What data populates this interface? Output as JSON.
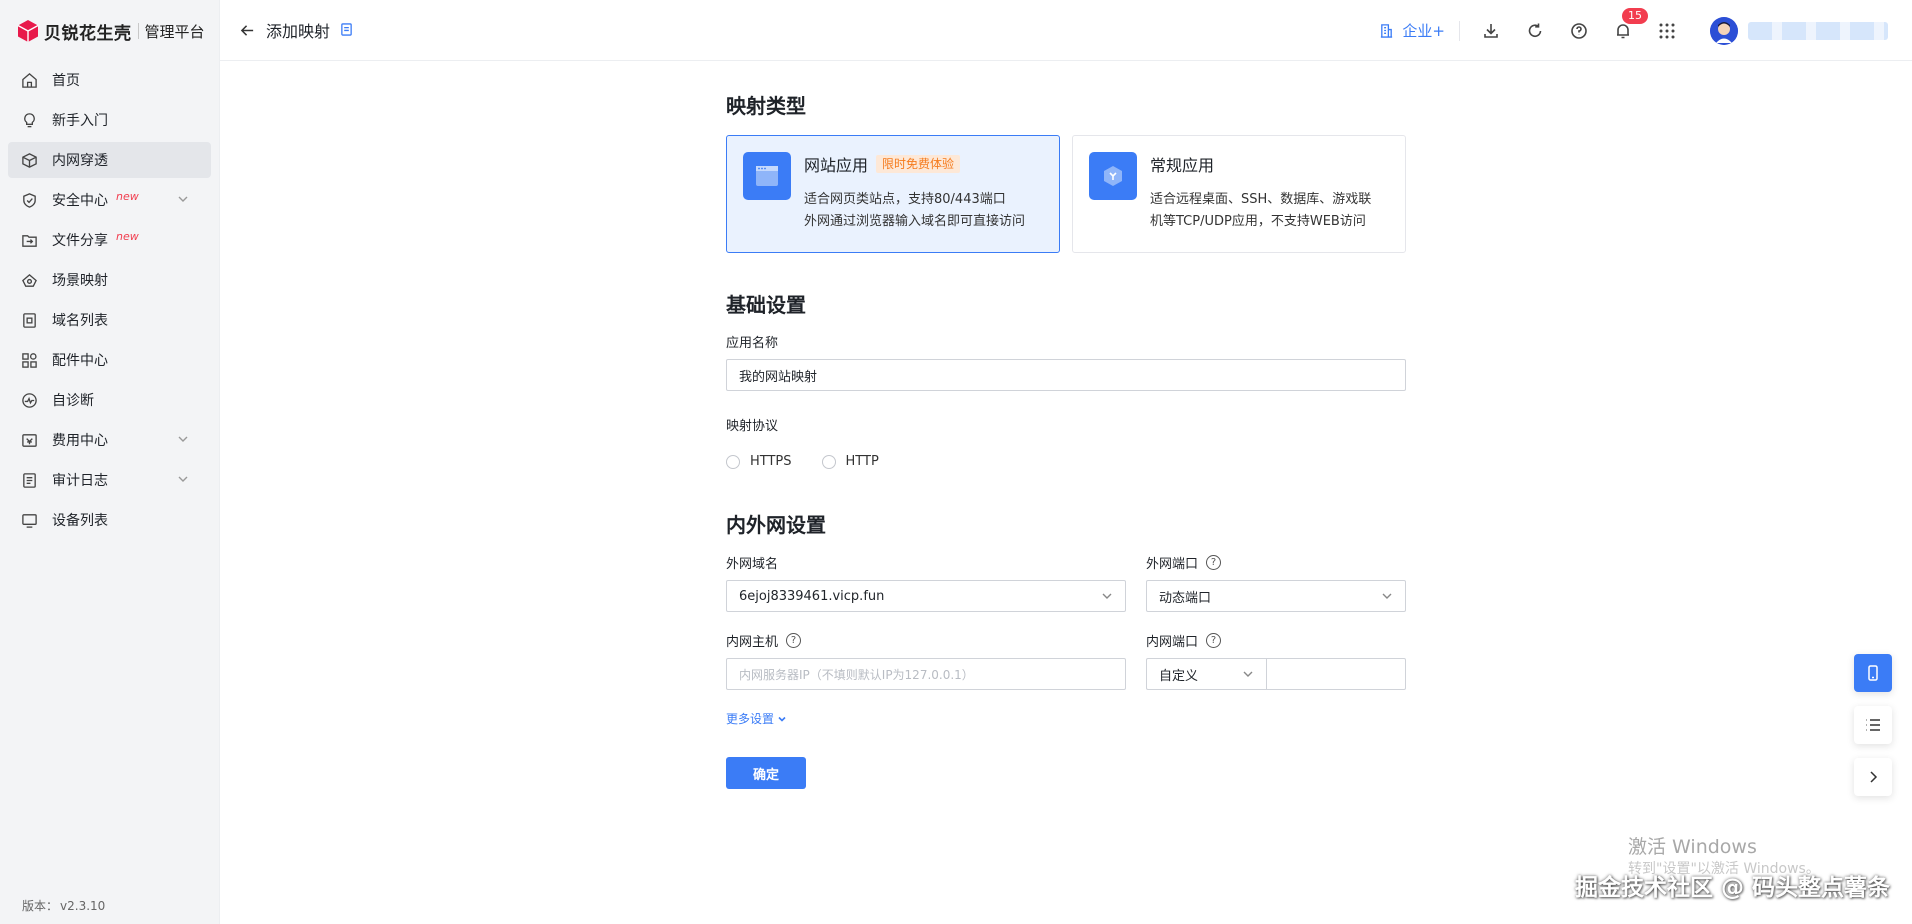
{
  "brand": {
    "name": "贝锐花生壳",
    "subtitle": "管理平台",
    "accent": "#e8194b"
  },
  "sidebar": {
    "items": [
      {
        "label": "首页",
        "icon": "home-icon",
        "new": "",
        "active": false
      },
      {
        "label": "新手入门",
        "icon": "lightbulb-icon",
        "new": "",
        "active": false
      },
      {
        "label": "内网穿透",
        "icon": "cube-icon",
        "new": "",
        "active": true
      },
      {
        "label": "安全中心",
        "icon": "shield-icon",
        "new": "new",
        "active": false
      },
      {
        "label": "文件分享",
        "icon": "folder-share-icon",
        "new": "new",
        "active": false
      },
      {
        "label": "场景映射",
        "icon": "scene-icon",
        "new": "",
        "active": false
      },
      {
        "label": "域名列表",
        "icon": "domain-icon",
        "new": "",
        "active": false
      },
      {
        "label": "配件中心",
        "icon": "grid-icon",
        "new": "",
        "active": false
      },
      {
        "label": "自诊断",
        "icon": "diagnose-icon",
        "new": "",
        "active": false
      },
      {
        "label": "费用中心",
        "icon": "wallet-icon",
        "new": "",
        "active": false
      },
      {
        "label": "审计日志",
        "icon": "log-icon",
        "new": "",
        "active": false
      },
      {
        "label": "设备列表",
        "icon": "monitor-icon",
        "new": "",
        "active": false
      }
    ],
    "version_label": "版本：",
    "version": "v2.3.10"
  },
  "header": {
    "title": "添加映射",
    "enterprise": "企业+",
    "notification_count": "15",
    "username": "████████"
  },
  "form": {
    "mapping_type_title": "映射类型",
    "types": [
      {
        "title": "网站应用",
        "tag": "限时免费体验",
        "desc1": "适合网页类站点，支持80/443端口",
        "desc2": "外网通过浏览器输入域名即可直接访问",
        "selected": true
      },
      {
        "title": "常规应用",
        "tag": "",
        "desc1": "适合远程桌面、SSH、数据库、游戏联",
        "desc2": "机等TCP/UDP应用，不支持WEB访问",
        "selected": false
      }
    ],
    "basic_title": "基础设置",
    "app_name_label": "应用名称",
    "app_name_value": "我的网站映射",
    "protocol_label": "映射协议",
    "protocols": [
      "HTTPS",
      "HTTP"
    ],
    "network_title": "内外网设置",
    "ext_domain_label": "外网域名",
    "ext_domain_value": "6ejoj8339461.vicp.fun",
    "ext_port_label": "外网端口",
    "ext_port_value": "动态端口",
    "int_host_label": "内网主机",
    "int_host_placeholder": "内网服务器IP（不填则默认IP为127.0.0.1）",
    "int_port_label": "内网端口",
    "int_port_mode": "自定义",
    "int_port_value": "",
    "more_settings": "更多设置",
    "confirm": "确定"
  },
  "watermarks": {
    "windows1": "激活 Windows",
    "windows2": "转到\"设置\"以激活 Windows。",
    "site": "掘金技术社区 @ 码头整点薯条"
  },
  "colors": {
    "primary": "#3b7cf6",
    "tag_text": "#f57b1d",
    "badge": "#f23d4f"
  }
}
